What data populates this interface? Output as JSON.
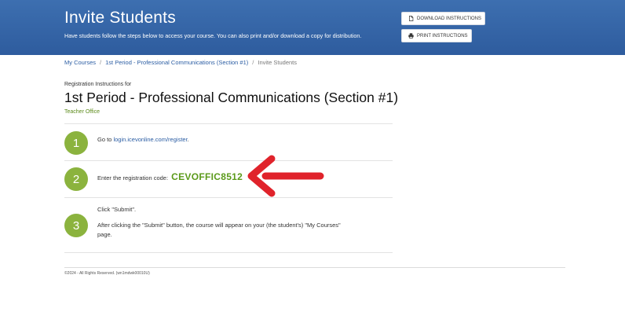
{
  "header": {
    "title": "Invite Students",
    "subtitle": "Have students follow the steps below to access your course. You can also print and/or download a copy for distribution.",
    "download_button": "DOWNLOAD INSTRUCTIONS",
    "print_button": "PRINT INSTRUCTIONS",
    "background_color": "#3365a8"
  },
  "breadcrumb": {
    "items": [
      "My Courses",
      "1st Period - Professional Communications (Section #1)",
      "Invite Students"
    ],
    "separator": "/"
  },
  "instructions": {
    "label": "Registration Instructions for",
    "course_title": "1st Period - Professional Communications (Section #1)",
    "teacher": "Teacher Office"
  },
  "steps": [
    {
      "number": "1",
      "prefix": "Go to ",
      "link": "login.icevonline.com/register",
      "suffix": "."
    },
    {
      "number": "2",
      "prefix": "Enter the registration code:",
      "code": "CEVOFFIC8512"
    },
    {
      "number": "3",
      "line1": "Click \"Submit\".",
      "line2": "After clicking the \"Submit\" button, the course will appear on your (the student's) \"My Courses\" page."
    }
  ],
  "accent_colors": {
    "step_circle": "#8bb33e",
    "code": "#5b9a1a",
    "arrow": "#e0232b"
  },
  "footer": {
    "text": "©2024 - All Rights Reserved. (wn1mdwk00010U)"
  }
}
